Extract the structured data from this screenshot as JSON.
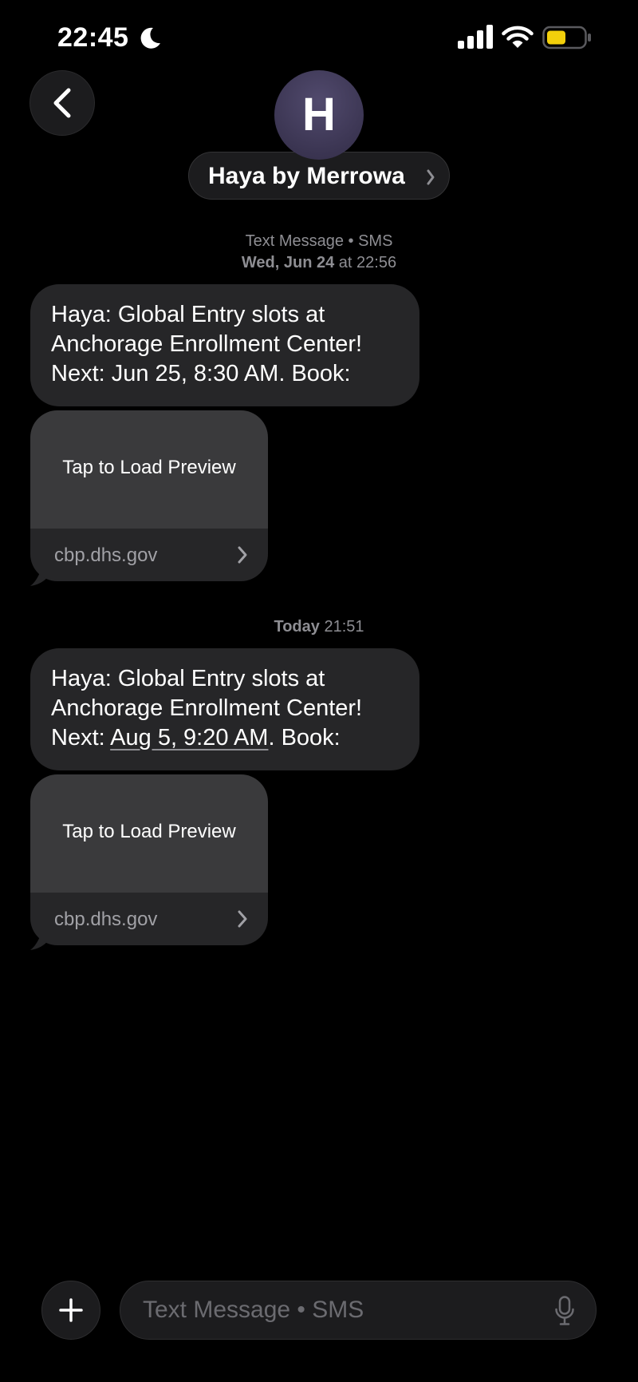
{
  "status_bar": {
    "time": "22:45",
    "icons": [
      "moon-icon",
      "signal-icon",
      "wifi-icon",
      "battery-icon"
    ],
    "battery_color": "#f2cf0b"
  },
  "header": {
    "back_icon": "chevron-left-icon",
    "avatar_letter": "H",
    "contact_name": "Haya by Merrowa"
  },
  "thread": {
    "groups": [
      {
        "meta_line1": "Text Message • SMS",
        "meta_line2_day": "Wed, Jun 24",
        "meta_line2_sep": " at ",
        "meta_line2_time": "22:56",
        "message_lines": [
          "Haya: Global Entry slots at",
          "Anchorage Enrollment Center!",
          "Next: Jun 25, 8:30 AM. Book:"
        ],
        "preview": {
          "label": "Tap to Load Preview",
          "domain": "cbp.dhs.gov"
        }
      },
      {
        "meta_day": "Today",
        "meta_time": "21:51",
        "message_line1": "Haya: Global Entry slots at",
        "message_line2": "Anchorage Enrollment Center!",
        "message_line3_prefix": "Next: ",
        "message_line3_link": "Aug 5, 9:20 AM",
        "message_line3_suffix": ". Book:",
        "preview": {
          "label": "Tap to Load Preview",
          "domain": "cbp.dhs.gov"
        }
      }
    ]
  },
  "composer": {
    "add_icon": "plus-icon",
    "placeholder": "Text Message • SMS",
    "value": "",
    "mic_icon": "microphone-icon"
  },
  "colors": {
    "background": "#000000",
    "bubble_incoming": "#262628",
    "preview_top": "#3a3a3c",
    "meta_text": "#8e8e93"
  }
}
